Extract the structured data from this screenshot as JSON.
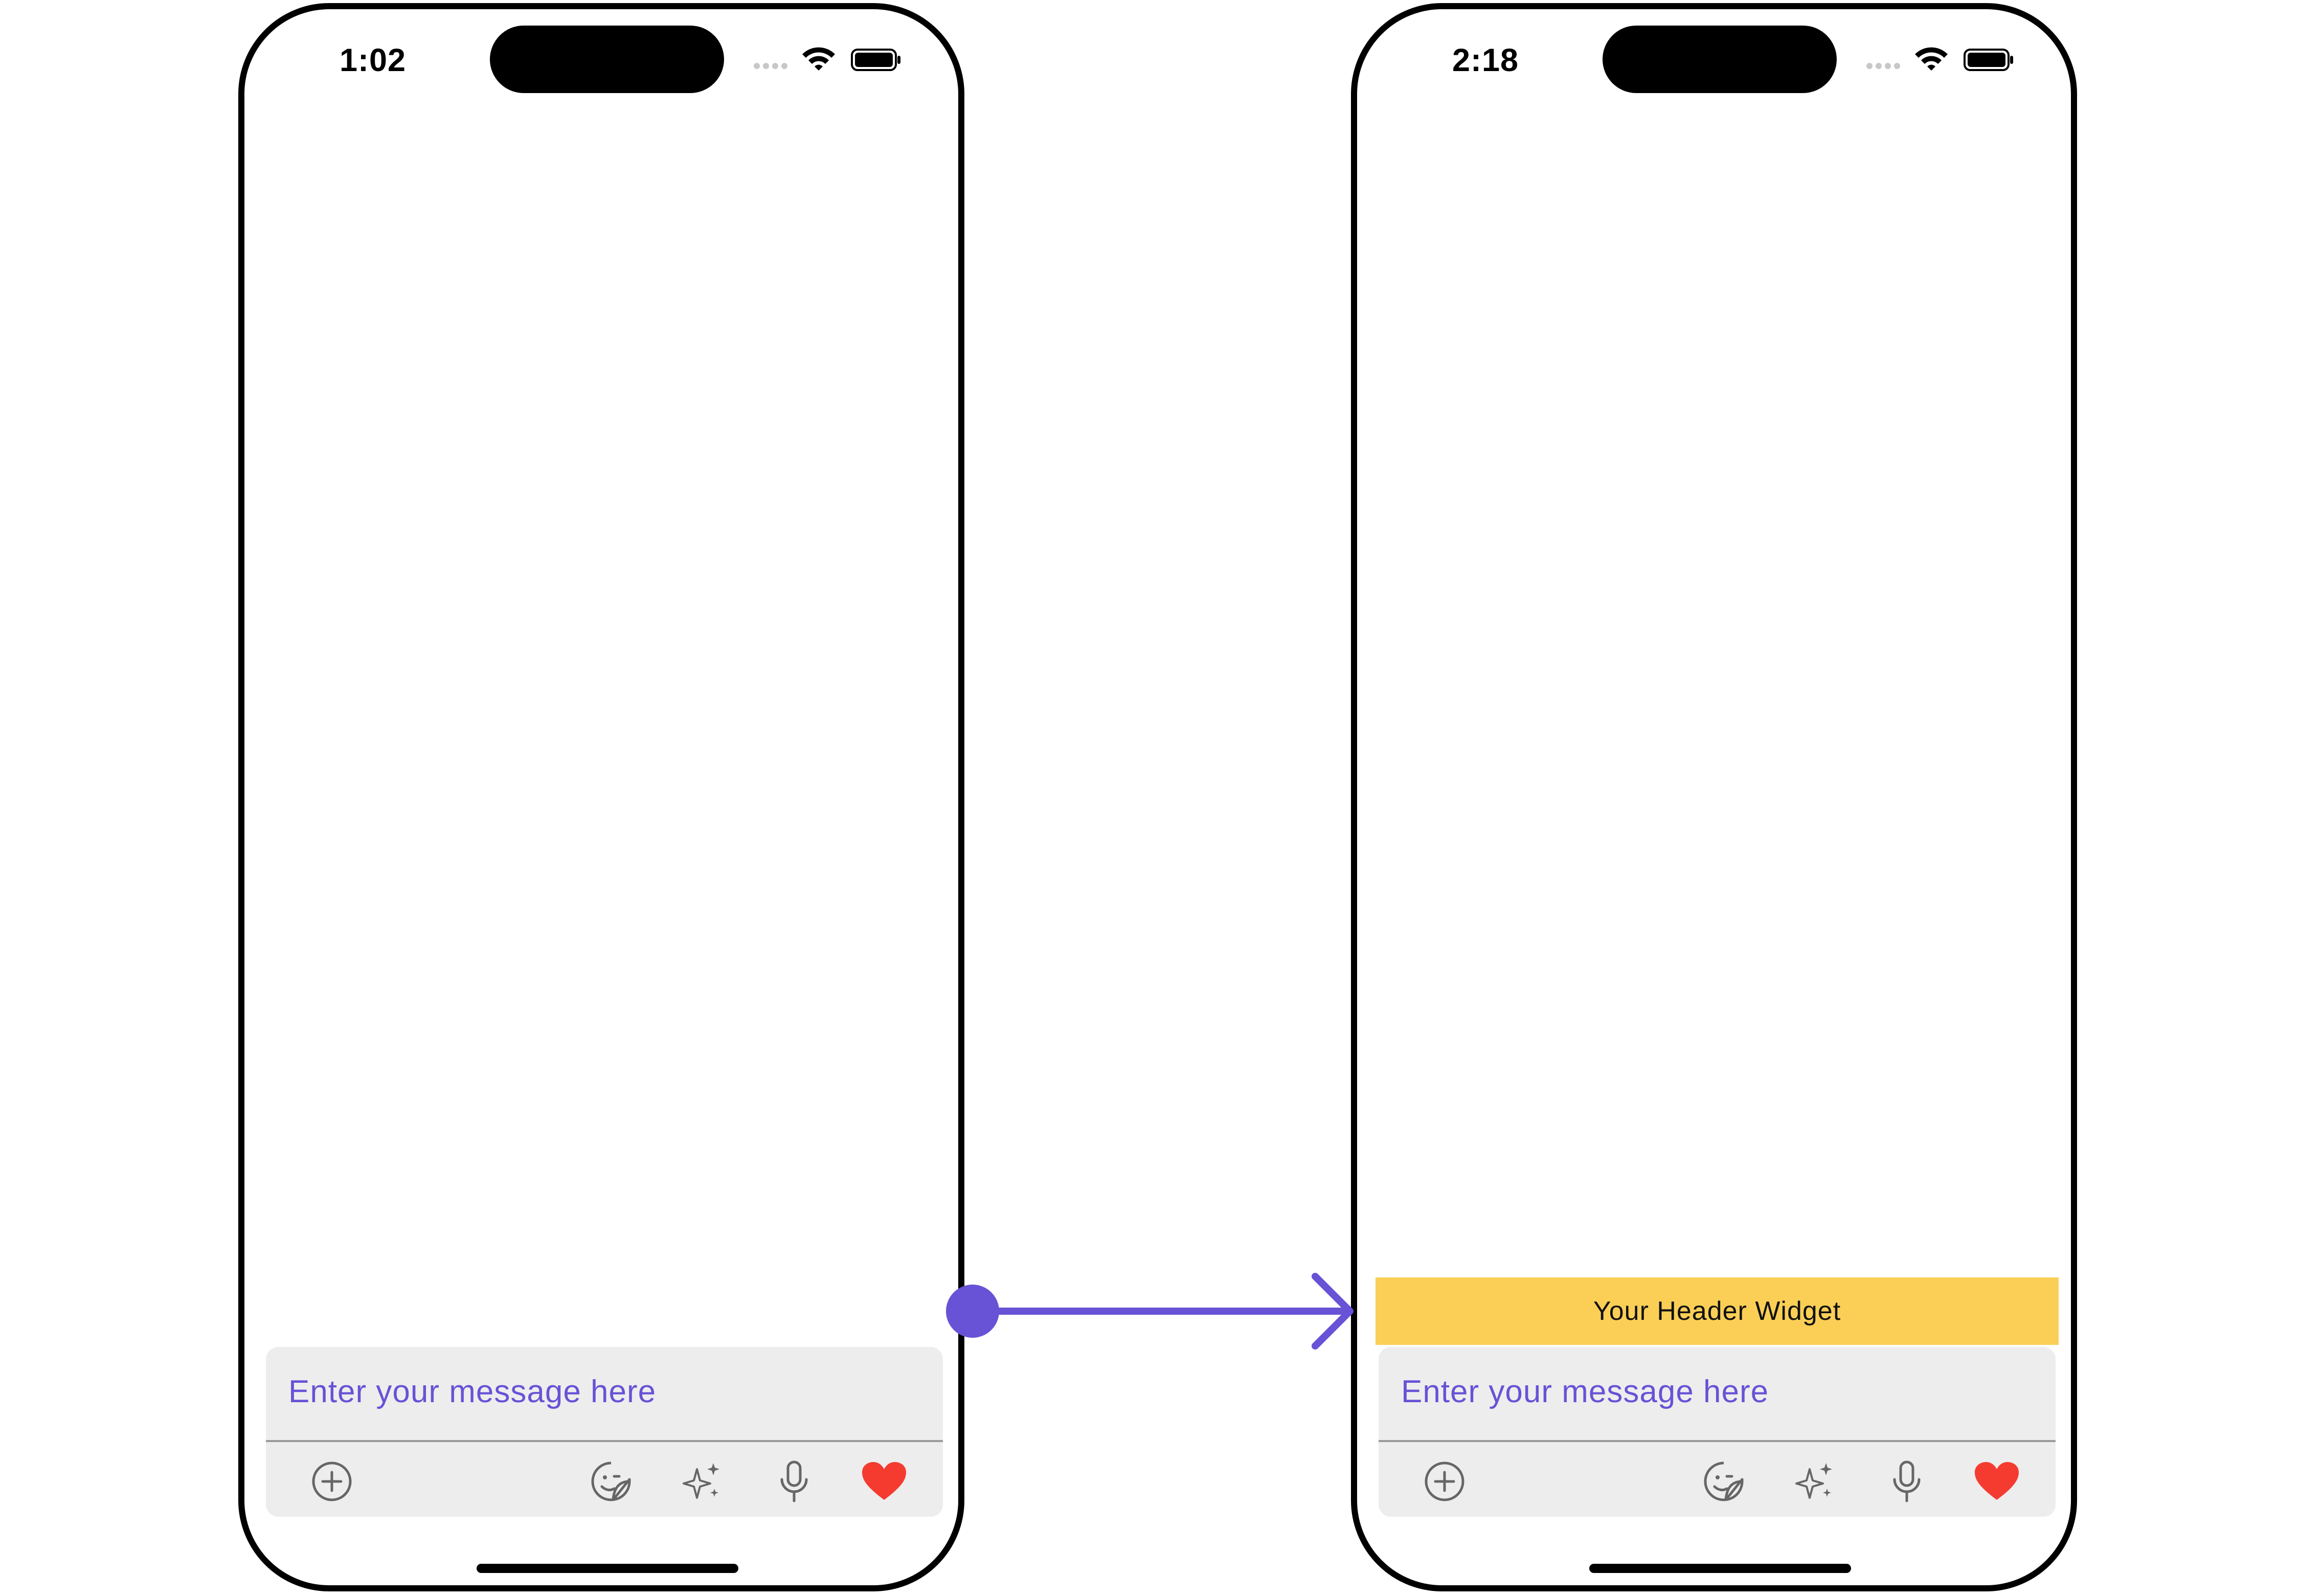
{
  "left_phone": {
    "status_time": "1:02",
    "composer": {
      "placeholder": "Enter your message here"
    }
  },
  "right_phone": {
    "status_time": "2:18",
    "header_widget": {
      "label": "Your Header Widget"
    },
    "composer": {
      "placeholder": "Enter your message here"
    }
  },
  "colors": {
    "accent": "#6852d6",
    "header_widget_bg": "#fbcf56",
    "composer_bg": "#ededed",
    "heart": "#f53b2f",
    "arrow": "#6852d6"
  },
  "toolbar_icons": [
    "add-circle-icon",
    "sticker-icon",
    "sparkles-icon",
    "microphone-icon",
    "heart-icon"
  ]
}
